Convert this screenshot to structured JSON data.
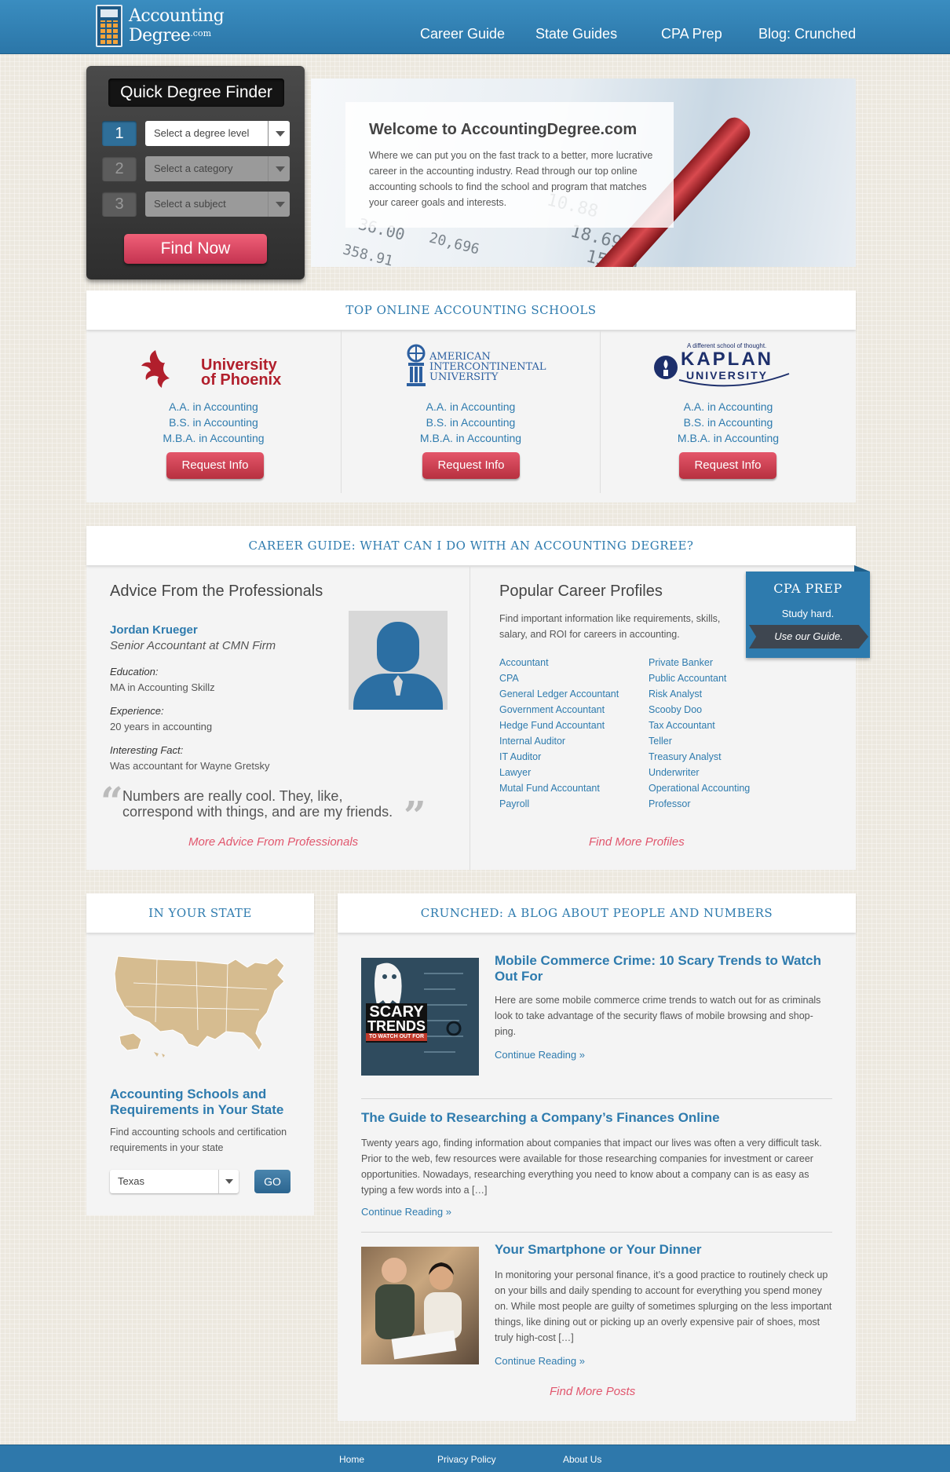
{
  "logo": {
    "line1": "Accounting",
    "line2": "Degree",
    "suffix": ".com"
  },
  "nav": {
    "items": [
      {
        "label": "Career Guide"
      },
      {
        "label": "State Guides"
      },
      {
        "label": "CPA Prep"
      },
      {
        "label": "Blog: Crunched"
      }
    ]
  },
  "finder": {
    "title": "Quick Degree Finder",
    "steps": [
      {
        "num": "1",
        "placeholder": "Select a degree level"
      },
      {
        "num": "2",
        "placeholder": "Select a category"
      },
      {
        "num": "3",
        "placeholder": "Select a subject"
      }
    ],
    "button": "Find Now"
  },
  "hero": {
    "title": "Welcome to AccountingDegree.com",
    "text": "Where we can put you on the fast track to a better, more lucrative career in the accounting industry. Read through our top online accounting schools to find the school and program that matches your career goals and interests."
  },
  "schools": {
    "heading": "TOP ONLINE ACCOUNTING SCHOOLS",
    "items": [
      {
        "logo_line1": "University",
        "logo_line2": "of Phoenix",
        "programs": [
          "A.A. in Accounting",
          "B.S. in Accounting",
          "M.B.A. in Accounting"
        ],
        "button": "Request Info"
      },
      {
        "logo_line1": "AMERICAN",
        "logo_line2": "INTERCONTINENTAL",
        "logo_line3": "UNIVERSITY",
        "programs": [
          "A.A. in Accounting",
          "B.S. in Accounting",
          "M.B.A. in Accounting"
        ],
        "button": "Request Info"
      },
      {
        "logo_tagline": "A different school of thought.",
        "logo_line1": "KAPLAN",
        "logo_line2": "UNIVERSITY",
        "programs": [
          "A.A. in Accounting",
          "B.S. in Accounting",
          "M.B.A. in Accounting"
        ],
        "button": "Request Info"
      }
    ]
  },
  "career": {
    "heading": "CAREER GUIDE: WHAT CAN I DO WITH AN ACCOUNTING DEGREE?",
    "advice": {
      "title": "Advice From the Professionals",
      "name": "Jordan Krueger",
      "role": "Senior Accountant at CMN Firm",
      "education_label": "Education",
      "education": "MA in Accounting Skillz",
      "experience_label": "Experience",
      "experience": "20 years in accounting",
      "fact_label": "Interesting Fact",
      "fact": "Was accountant for Wayne Gretsky",
      "quote": "Numbers are really cool. They, like, correspond with things, and are my friends.",
      "more": "More Advice From Professionals"
    },
    "profiles": {
      "title": "Popular Career Profiles",
      "intro": "Find important information like requirements, skills, salary, and ROI for careers in accounting.",
      "col1": [
        "Accountant",
        "CPA",
        "General Ledger Accountant",
        "Government Accountant",
        "Hedge Fund Accountant",
        "Internal Auditor",
        "IT Auditor",
        "Lawyer",
        "Mutal Fund Accountant",
        "Payroll"
      ],
      "col2": [
        "Private Banker",
        "Public Accountant",
        "Risk Analyst",
        "Scooby Doo",
        "Tax Accountant",
        "Teller",
        "Treasury Analyst",
        "Underwriter",
        "Operational Accounting",
        "Professor"
      ],
      "more": "Find More Profiles"
    },
    "cpa": {
      "title": "CPA PREP",
      "tagline": "Study hard.",
      "link": "Use our Guide."
    }
  },
  "state": {
    "heading": "IN YOUR STATE",
    "title": "Accounting Schools and Requirements in Your State",
    "desc": "Find accounting schools and certification requirements in your state",
    "selected": "Texas",
    "go": "GO"
  },
  "blog": {
    "heading": "CRUNCHED: A BLOG ABOUT PEOPLE AND NUMBERS",
    "posts": [
      {
        "title": "Mobile Commerce Crime: 10 Scary Trends to Watch Out For",
        "excerpt": "Here are some mobile commerce crime trends to watch out for as criminals look to take advantage of the security flaws of mobile browsing and shop-ping.",
        "more": "Continue Reading »",
        "thumb_line1": "SCARY",
        "thumb_line2": "TRENDS",
        "thumb_line3": "TO WATCH OUT FOR"
      },
      {
        "title": "The Guide to Researching a Company’s Finances Online",
        "excerpt": "Twenty years ago, finding information about companies that impact our lives was often a very difficult task. Prior to the web, few resources were available for those researching companies for investment or career opportunities. Nowadays, researching everything you need to know about a company can is as easy as typing a few words into a […]",
        "more": "Continue Reading »"
      },
      {
        "title": "Your Smartphone or Your Dinner",
        "excerpt": "In monitoring your personal finance, it’s a good practice to routinely check up on your bills and daily spending to account for everything you spend money on. While most people are guilty of sometimes splurging on the less important things, like dining out or picking up an overly expensive pair of shoes, most truly high-cost […]",
        "more": "Continue Reading »"
      }
    ],
    "more": "Find More Posts"
  },
  "footer": {
    "links": [
      {
        "label": "Home"
      },
      {
        "label": "Privacy Policy"
      },
      {
        "label": "About Us"
      }
    ]
  },
  "colors": {
    "brand_blue": "#2e7bae",
    "header_blue": "#3a8dc0",
    "accent_pink": "#e1566d",
    "button_red": "#c43350"
  }
}
